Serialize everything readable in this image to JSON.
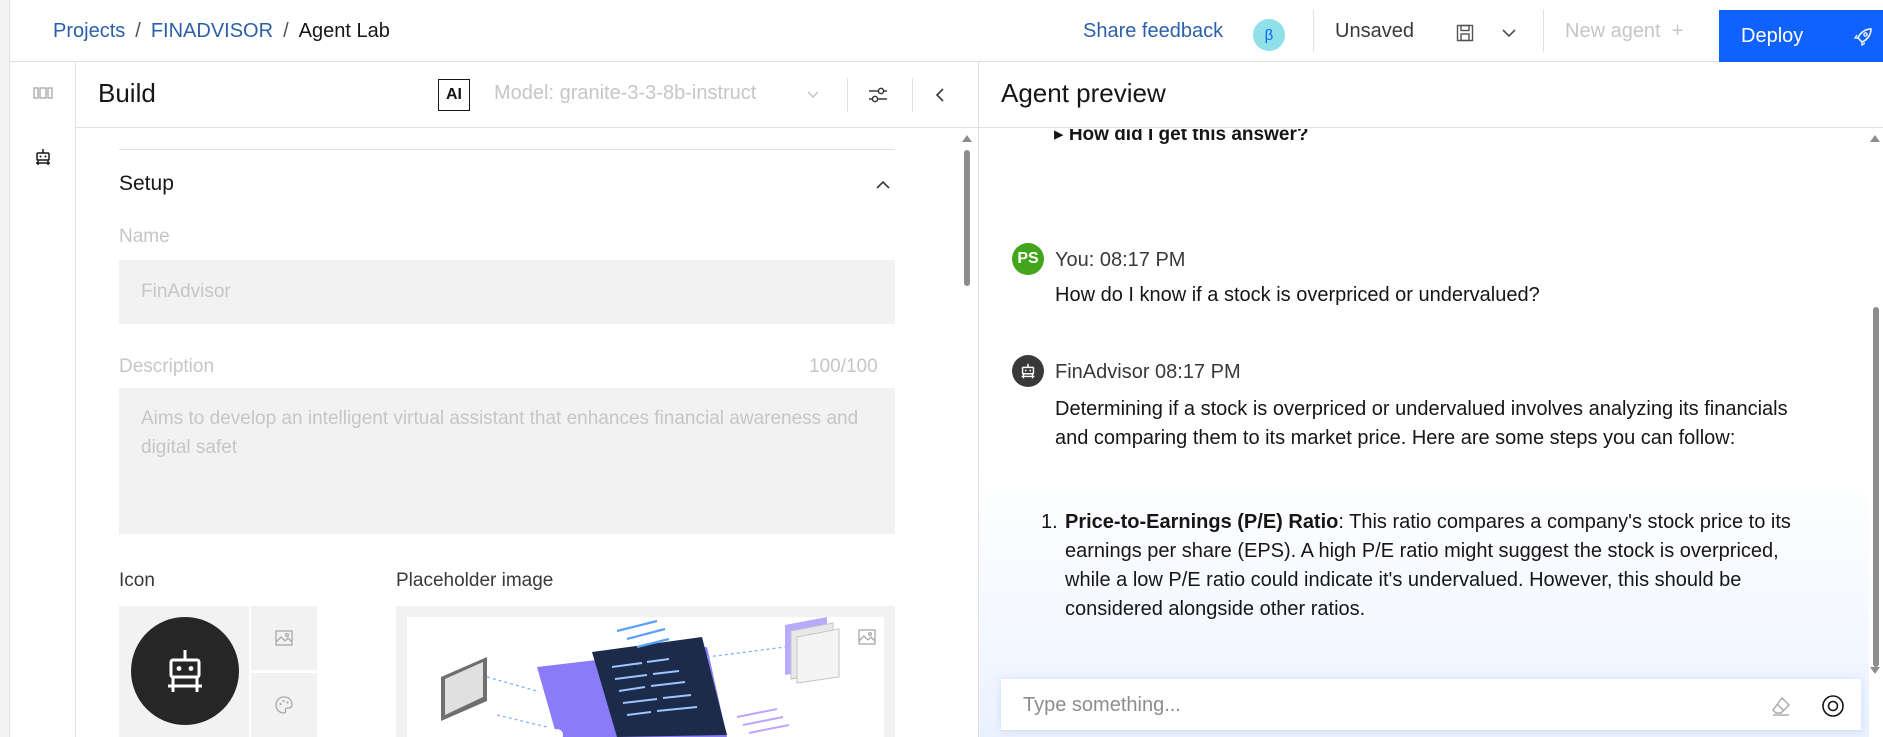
{
  "header": {
    "breadcrumb": [
      "Projects",
      "FINADVISOR",
      "Agent Lab"
    ],
    "separator": "/",
    "share_feedback": "Share feedback",
    "beta": "β",
    "unsaved": "Unsaved",
    "new_agent": "New agent",
    "new_agent_plus": "+",
    "deploy": "Deploy"
  },
  "build": {
    "title": "Build",
    "ai_badge": "AI",
    "model": "Model: granite-3-3-8b-instruct",
    "setup_title": "Setup",
    "name_label": "Name",
    "name_value": "FinAdvisor",
    "description_label": "Description",
    "description_counter": "100/100",
    "description_value": "Aims to develop an intelligent virtual assistant that enhances financial awareness and digital safet",
    "icon_label": "Icon",
    "placeholder_image_label": "Placeholder image"
  },
  "preview": {
    "title": "Agent preview",
    "how_line": "▸ How did I get this answer?",
    "user_initials": "PS",
    "user_meta": "You: 08:17 PM",
    "user_message": "How do I know if a stock is overpriced or undervalued?",
    "agent_meta": "FinAdvisor 08:17 PM",
    "agent_intro": "Determining if a stock is overpriced or undervalued involves analyzing its financials and comparing them to its market price. Here are some steps you can follow:",
    "list": [
      {
        "num": "1.",
        "bold": "Price-to-Earnings (P/E) Ratio",
        "text": ": This ratio compares a company's stock price to its earnings per share (EPS). A high P/E ratio might suggest the stock is overpriced, while a low P/E ratio could indicate it's undervalued. However, this should be considered alongside other ratios."
      }
    ],
    "input_placeholder": "Type something..."
  },
  "colors": {
    "accent": "#0f62fe",
    "link": "#2b5fa8",
    "user_avatar": "#42a51b",
    "agent_avatar": "#393939"
  }
}
